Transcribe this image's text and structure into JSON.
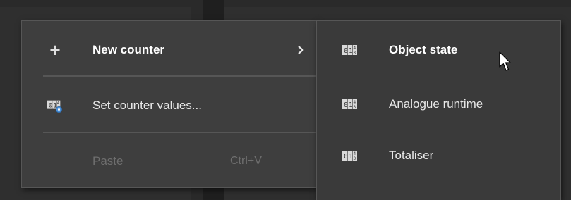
{
  "context_menu": {
    "items": [
      {
        "label": "New counter",
        "icon": "plus-icon",
        "has_submenu": true
      },
      {
        "label": "Set counter values...",
        "icon": "counter-settings-icon"
      },
      {
        "label": "Paste",
        "shortcut": "Ctrl+V",
        "disabled": true
      }
    ]
  },
  "submenu": {
    "items": [
      {
        "label": "Object state",
        "icon": "counter-icon",
        "highlighted": true
      },
      {
        "label": "Analogue runtime",
        "icon": "counter-icon"
      },
      {
        "label": "Totaliser",
        "icon": "counter-icon"
      }
    ]
  },
  "colors": {
    "menu_bg": "#3e3e3e",
    "submenu_bg": "#3a3a3a",
    "divider": "#565656",
    "text": "#e8e8e8",
    "text_disabled": "#6e6e6e",
    "icon_accent": "#4a90d9"
  }
}
